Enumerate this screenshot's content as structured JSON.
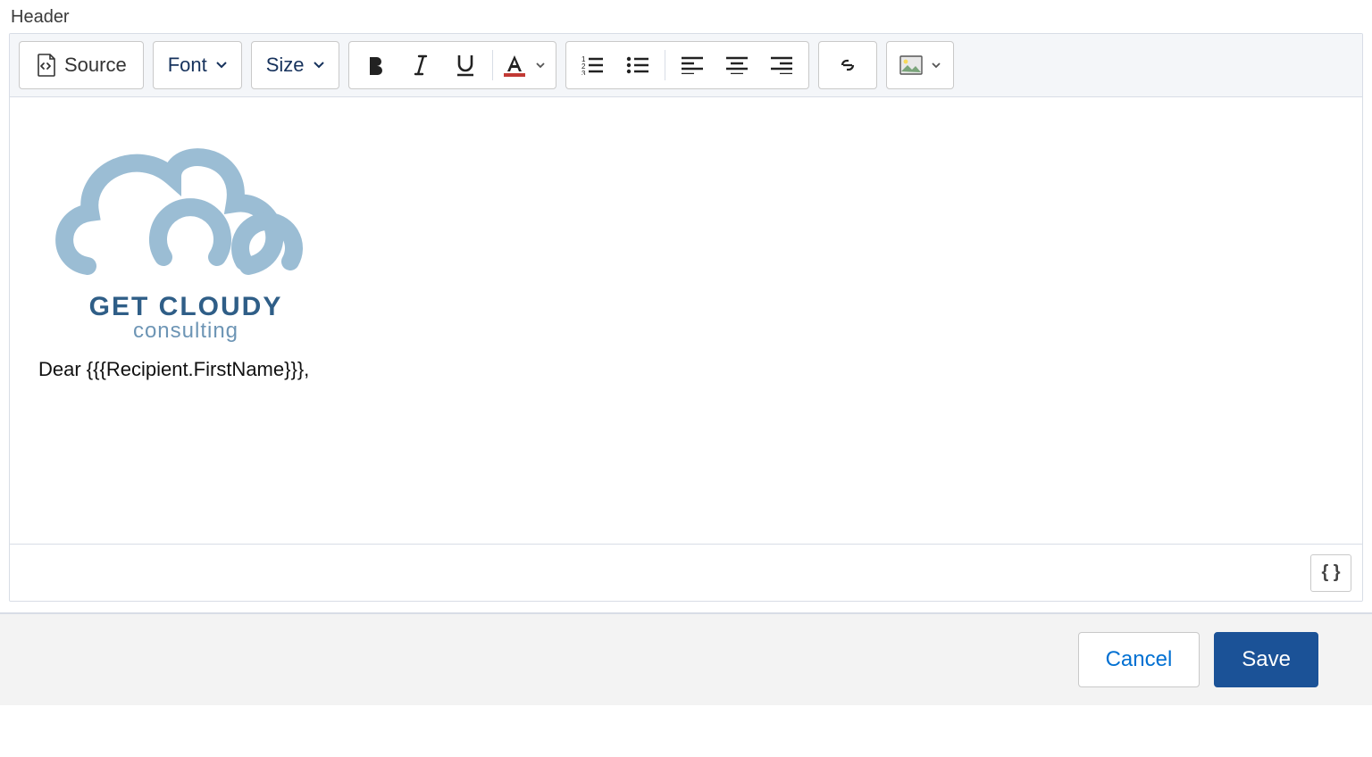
{
  "field_label": "Header",
  "toolbar": {
    "source_label": "Source",
    "font_label": "Font",
    "size_label": "Size"
  },
  "content": {
    "logo_line1": "GET CLOUDY",
    "logo_line2": "consulting",
    "greeting": "Dear {{{Recipient.FirstName}}},"
  },
  "footer": {
    "merge_label": "{ }",
    "cancel": "Cancel",
    "save": "Save"
  }
}
